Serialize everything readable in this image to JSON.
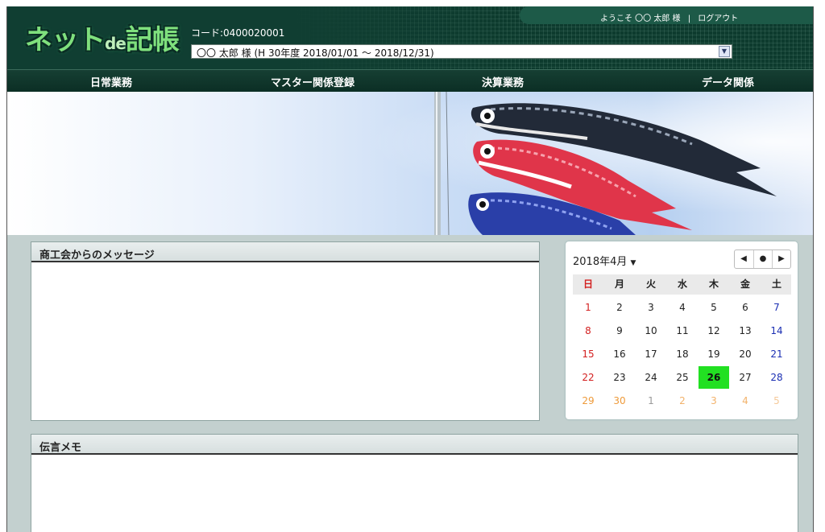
{
  "header": {
    "logo_text": "ネット",
    "logo_text_de": "de",
    "logo_text_end": "記帳",
    "code_label": "コード:0400020001",
    "period_select_value": "〇〇 太郎 様 (H 30年度 2018/01/01 ～ 2018/12/31)",
    "welcome_text": "ようこそ 〇〇 太郎 様",
    "separator": "|",
    "logout_label": "ログアウト"
  },
  "nav": {
    "items": [
      {
        "label": "日常業務"
      },
      {
        "label": "マスター関係登録"
      },
      {
        "label": "決算業務"
      },
      {
        "label": "データ関係"
      }
    ]
  },
  "panels": {
    "message_title": "商工会からのメッセージ",
    "memo_title": "伝言メモ"
  },
  "calendar": {
    "month_label": "2018年4月",
    "prev_icon": "◀",
    "today_icon": "●",
    "next_icon": "▶",
    "weekdays": [
      "日",
      "月",
      "火",
      "水",
      "木",
      "金",
      "土"
    ],
    "weeks": [
      [
        "1",
        "2",
        "3",
        "4",
        "5",
        "6",
        "7"
      ],
      [
        "8",
        "9",
        "10",
        "11",
        "12",
        "13",
        "14"
      ],
      [
        "15",
        "16",
        "17",
        "18",
        "19",
        "20",
        "21"
      ],
      [
        "22",
        "23",
        "24",
        "25",
        "26",
        "27",
        "28"
      ],
      [
        "29",
        "30",
        "1",
        "2",
        "3",
        "4",
        "5"
      ]
    ],
    "today": "26",
    "colors": {
      "sunday": "#d32020",
      "saturday": "#1b2fb3",
      "today_bg": "#22e022"
    }
  },
  "icons": {
    "select_arrow": "chevron-down-icon",
    "month_dropdown": "caret-down-icon"
  }
}
